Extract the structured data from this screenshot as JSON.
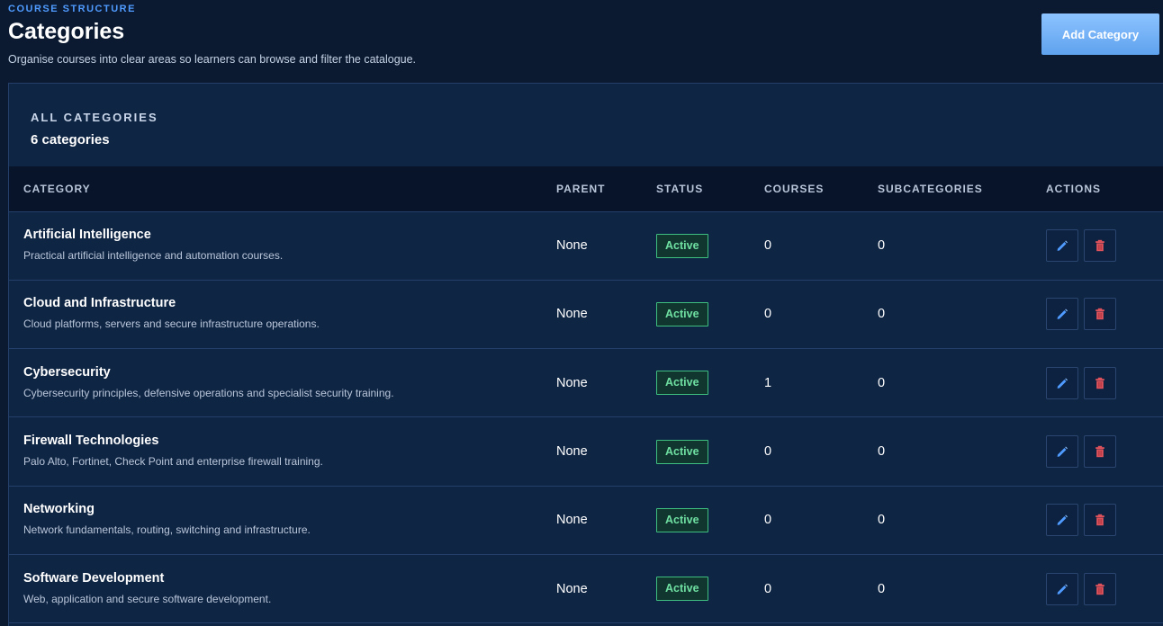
{
  "header": {
    "eyebrow": "COURSE STRUCTURE",
    "title": "Categories",
    "subtitle": "Organise courses into clear areas so learners can browse and filter the catalogue.",
    "add_button_label": "Add Category"
  },
  "panel": {
    "label": "ALL CATEGORIES",
    "count": "6 categories"
  },
  "table": {
    "columns": [
      "CATEGORY",
      "PARENT",
      "STATUS",
      "COURSES",
      "SUBCATEGORIES",
      "ACTIONS"
    ],
    "rows": [
      {
        "name": "Artificial Intelligence",
        "description": "Practical artificial intelligence and automation courses.",
        "parent": "None",
        "status": "Active",
        "courses": "0",
        "subcategories": "0"
      },
      {
        "name": "Cloud and Infrastructure",
        "description": "Cloud platforms, servers and secure infrastructure operations.",
        "parent": "None",
        "status": "Active",
        "courses": "0",
        "subcategories": "0"
      },
      {
        "name": "Cybersecurity",
        "description": "Cybersecurity principles, defensive operations and specialist security training.",
        "parent": "None",
        "status": "Active",
        "courses": "1",
        "subcategories": "0"
      },
      {
        "name": "Firewall Technologies",
        "description": "Palo Alto, Fortinet, Check Point and enterprise firewall training.",
        "parent": "None",
        "status": "Active",
        "courses": "0",
        "subcategories": "0"
      },
      {
        "name": "Networking",
        "description": "Network fundamentals, routing, switching and infrastructure.",
        "parent": "None",
        "status": "Active",
        "courses": "0",
        "subcategories": "0"
      },
      {
        "name": "Software Development",
        "description": "Web, application and secure software development.",
        "parent": "None",
        "status": "Active",
        "courses": "0",
        "subcategories": "0"
      }
    ]
  },
  "icons": {
    "edit": "pencil-icon",
    "delete": "trash-icon"
  },
  "colors": {
    "accent": "#4f9bff",
    "active_status": "#6fe0a2",
    "delete_icon": "#e0535c",
    "edit_icon": "#4f9bff"
  }
}
